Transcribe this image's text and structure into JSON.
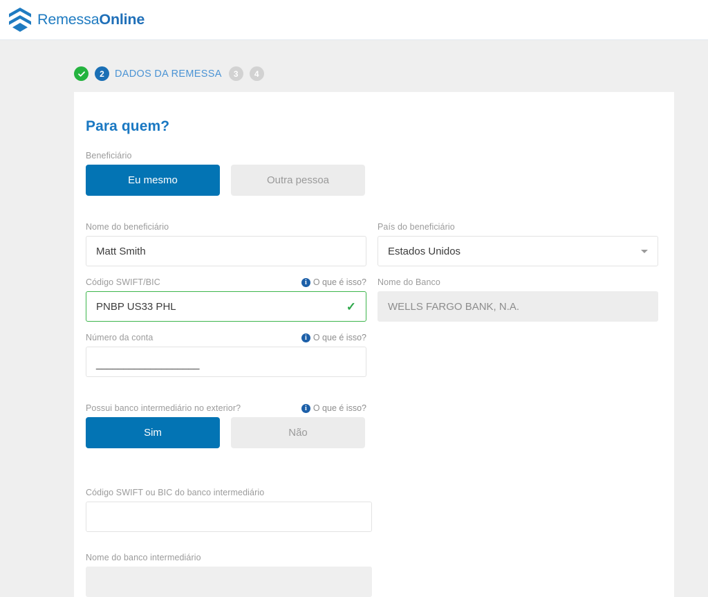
{
  "header": {
    "brand_primary": "Remessa",
    "brand_secondary": "Online",
    "logo_icon": "chevron-stack-logo-icon"
  },
  "stepper": {
    "steps": [
      {
        "id": "step-1",
        "value": "check-icon",
        "state": "done",
        "label": ""
      },
      {
        "id": "step-2",
        "value": "2",
        "state": "current",
        "label": "DADOS DA REMESSA"
      },
      {
        "id": "step-3",
        "value": "3",
        "state": "future",
        "label": ""
      },
      {
        "id": "step-4",
        "value": "4",
        "state": "future",
        "label": ""
      }
    ]
  },
  "card": {
    "title": "Para quem?",
    "beneficiary_toggle": {
      "label": "Beneficiário",
      "option_self": "Eu mesmo",
      "option_other": "Outra pessoa",
      "selected": "Eu mesmo"
    },
    "beneficiary_name": {
      "label": "Nome do beneficiário",
      "value": "Matt Smith",
      "placeholder": ""
    },
    "beneficiary_country": {
      "label": "País do beneficiário",
      "value": "Estados Unidos",
      "caret_icon": "chevron-down-icon"
    },
    "swift_code": {
      "label": "Código SWIFT/BIC",
      "hint": "O que é isso?",
      "hint_icon": "info-icon",
      "value": "PNBP US33 PHL",
      "valid": true,
      "valid_icon": "check-icon"
    },
    "bank_name": {
      "label": "Nome do Banco",
      "value": "WELLS FARGO BANK, N.A.",
      "readonly": true
    },
    "account_number": {
      "label": "Número da conta",
      "hint": "O que é isso?",
      "hint_icon": "info-icon",
      "value": "___________________",
      "placeholder": ""
    },
    "intermediary_toggle": {
      "label": "Possui banco intermediário no exterior?",
      "hint": "O que é isso?",
      "hint_icon": "info-icon",
      "option_yes": "Sim",
      "option_no": "Não",
      "selected": "Sim"
    },
    "intermediary_swift": {
      "label": "Código SWIFT ou BIC do banco intermediário",
      "value": "",
      "placeholder": ""
    },
    "intermediary_bank_name": {
      "label": "Nome do banco intermediário",
      "value": "",
      "readonly": true
    }
  },
  "colors": {
    "brand_blue": "#1f7bc1",
    "accent_blue": "#0374b4",
    "step_current": "#1a6fb5",
    "step_done_green": "#24b33f",
    "valid_green": "#3cb54b",
    "page_bg": "#efefef",
    "card_bg": "#ffffff",
    "label_gray": "#9b9b9b",
    "readonly_bg": "#ededed"
  }
}
